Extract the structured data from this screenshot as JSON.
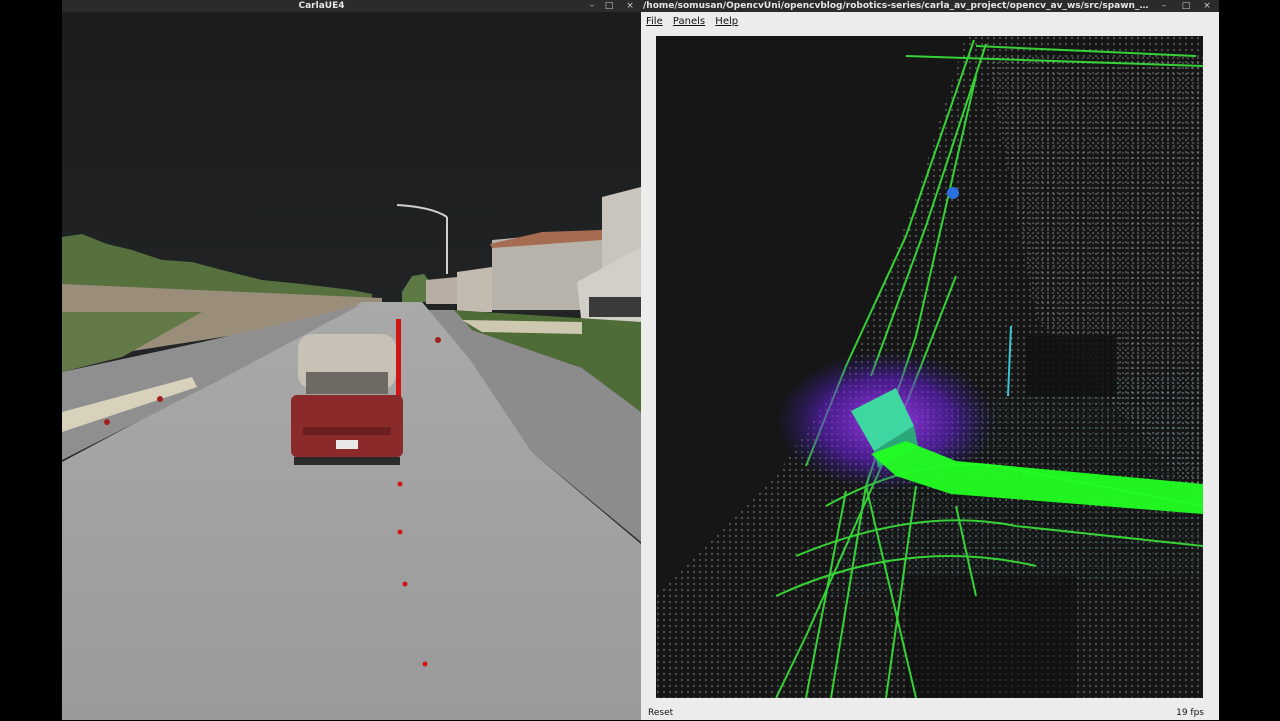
{
  "carla_window": {
    "title": "CarlaUE4",
    "controls": [
      "–",
      "□",
      "×"
    ]
  },
  "rviz_window": {
    "title": "/home/somusan/OpencvUni/opencvblog/robotics-series/carla_av_project/opencv_av_ws/src/spawn_vehicle/rviz/ca...",
    "controls": [
      "–",
      "□",
      "×"
    ],
    "menu": {
      "file": "File",
      "panels": "Panels",
      "help": "Help"
    },
    "status": {
      "reset_label": "Reset",
      "fps": "19 fps"
    }
  },
  "colors": {
    "lidar_green": "#39e639",
    "path_green": "#22ff22",
    "vehicle_marker": "#3fd7a0",
    "lidar_purple": "#8a2be2",
    "lidar_cyan": "#3cc6d6"
  }
}
